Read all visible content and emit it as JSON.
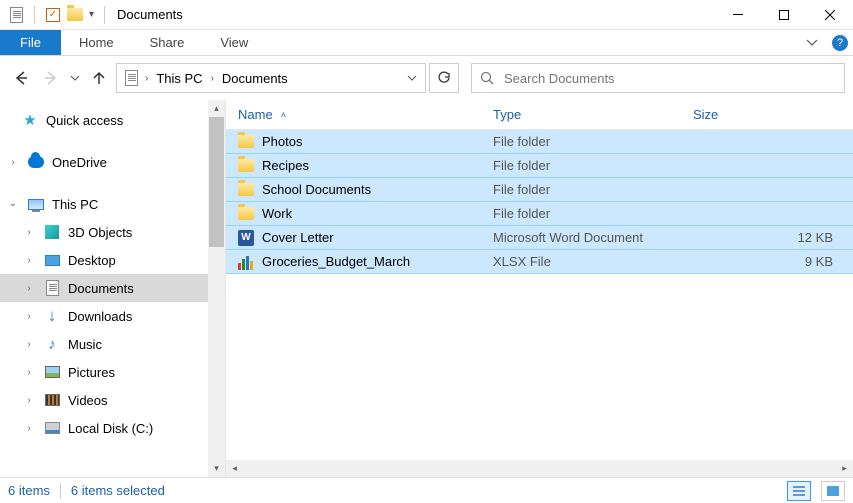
{
  "window": {
    "title": "Documents"
  },
  "ribbon": {
    "file": "File",
    "tabs": [
      "Home",
      "Share",
      "View"
    ]
  },
  "address": {
    "crumbs": [
      "This PC",
      "Documents"
    ]
  },
  "search": {
    "placeholder": "Search Documents"
  },
  "nav": {
    "quick_access": "Quick access",
    "onedrive": "OneDrive",
    "this_pc": "This PC",
    "items": [
      {
        "label": "3D Objects",
        "icon": "3d"
      },
      {
        "label": "Desktop",
        "icon": "desktop"
      },
      {
        "label": "Documents",
        "icon": "doc",
        "selected": true
      },
      {
        "label": "Downloads",
        "icon": "download"
      },
      {
        "label": "Music",
        "icon": "music"
      },
      {
        "label": "Pictures",
        "icon": "pictures"
      },
      {
        "label": "Videos",
        "icon": "video"
      },
      {
        "label": "Local Disk (C:)",
        "icon": "disk"
      }
    ]
  },
  "columns": {
    "name": "Name",
    "type": "Type",
    "size": "Size"
  },
  "files": [
    {
      "name": "Photos",
      "type": "File folder",
      "size": "",
      "icon": "folder"
    },
    {
      "name": "Recipes",
      "type": "File folder",
      "size": "",
      "icon": "folder"
    },
    {
      "name": "School Documents",
      "type": "File folder",
      "size": "",
      "icon": "folder"
    },
    {
      "name": "Work",
      "type": "File folder",
      "size": "",
      "icon": "folder"
    },
    {
      "name": "Cover Letter",
      "type": "Microsoft Word Document",
      "size": "12 KB",
      "icon": "word"
    },
    {
      "name": "Groceries_Budget_March",
      "type": "XLSX File",
      "size": "9 KB",
      "icon": "xlsx"
    }
  ],
  "status": {
    "count": "6 items",
    "selected": "6 items selected"
  }
}
